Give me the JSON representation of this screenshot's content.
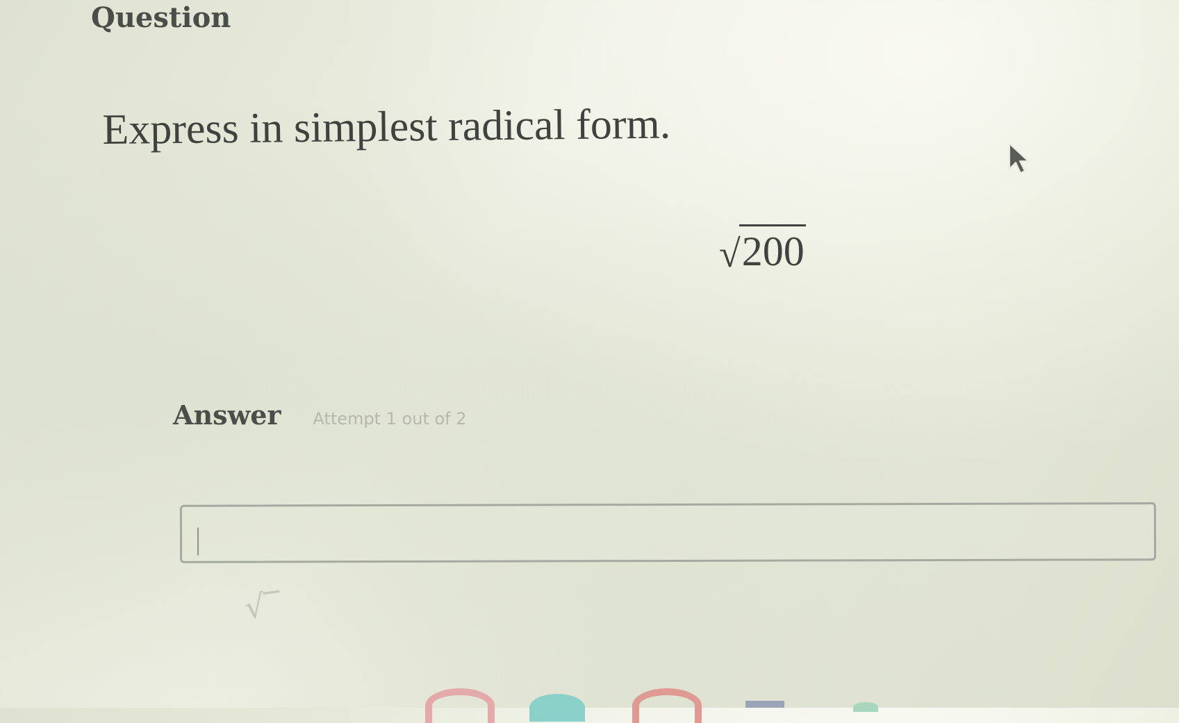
{
  "question": {
    "section_title": "Question",
    "prompt": "Express in simplest radical form.",
    "expression": {
      "radical": "√",
      "radicand": "200"
    }
  },
  "answer": {
    "label": "Answer",
    "attempt_text": "Attempt 1 out of 2",
    "input": {
      "value": "",
      "placeholder": ""
    },
    "tools": {
      "sqrt_symbol": "√‾"
    }
  },
  "icons": {
    "pointer": "mouse-pointer-icon"
  },
  "colors": {
    "background": "#e6e8d9",
    "text": "#3f423d",
    "input_border": "#a6a9a0"
  }
}
